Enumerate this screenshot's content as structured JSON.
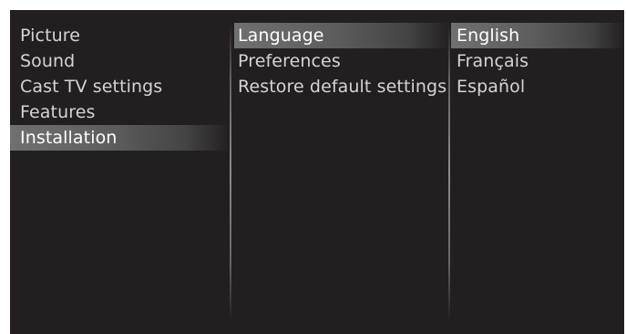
{
  "menu": {
    "main": [
      {
        "label": "Picture",
        "selected": false
      },
      {
        "label": "Sound",
        "selected": false
      },
      {
        "label": "Cast TV settings",
        "selected": false
      },
      {
        "label": "Features",
        "selected": false
      },
      {
        "label": "Installation",
        "selected": true
      }
    ],
    "installation": [
      {
        "label": "Language",
        "selected": true
      },
      {
        "label": "Preferences",
        "selected": false
      },
      {
        "label": "Restore default settings",
        "selected": false
      }
    ],
    "language": [
      {
        "label": "English",
        "selected": true
      },
      {
        "label": "Français",
        "selected": false
      },
      {
        "label": "Español",
        "selected": false
      }
    ]
  },
  "colors": {
    "background": "#231f20",
    "text": "#d4d4d4",
    "highlight_text": "#ffffff",
    "highlight": "#707070"
  }
}
